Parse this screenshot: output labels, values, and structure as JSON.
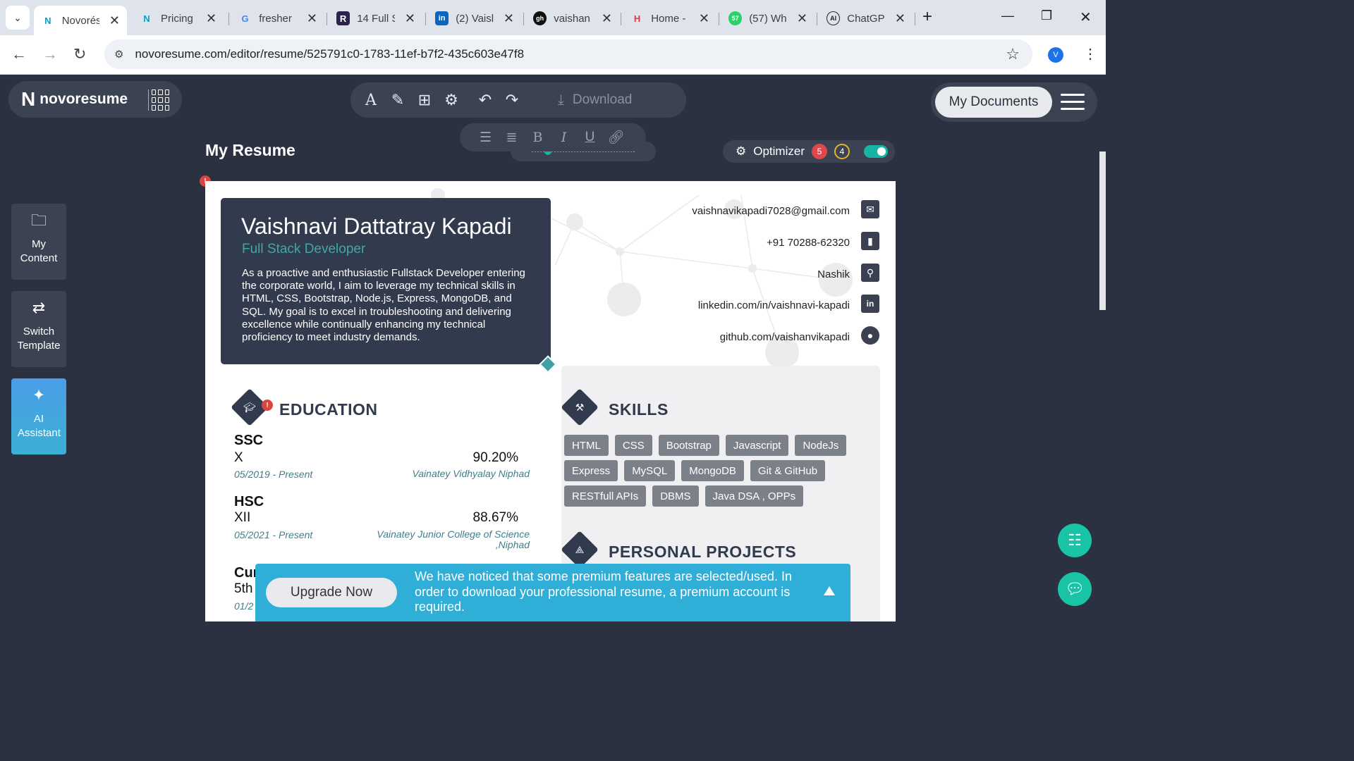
{
  "browser": {
    "tabs": [
      {
        "title": "Novorés",
        "favicon": "N",
        "active": true
      },
      {
        "title": "Pricing |",
        "favicon": "N"
      },
      {
        "title": "fresher",
        "favicon": "G"
      },
      {
        "title": "14 Full S",
        "favicon": "R"
      },
      {
        "title": "(2) Vaisl",
        "favicon": "in"
      },
      {
        "title": "vaishan",
        "favicon": "gh"
      },
      {
        "title": "Home -",
        "favicon": "H"
      },
      {
        "title": "(57) Wh",
        "favicon": "57"
      },
      {
        "title": "ChatGP",
        "favicon": "AI"
      }
    ],
    "url": "novoresume.com/editor/resume/525791c0-1783-11ef-b7f2-435c603e47f8",
    "profile_initial": "V",
    "new_tab": "+"
  },
  "app": {
    "brand": "novoresume",
    "toolbar": {
      "download_label": "Download"
    },
    "my_documents_label": "My Documents",
    "page_title": "My Resume",
    "optimizer": {
      "label": "Optimizer",
      "errors": "5",
      "warnings": "4",
      "enabled": true
    },
    "sidebar": [
      {
        "label": "My Content"
      },
      {
        "label": "Switch Template"
      },
      {
        "label": "AI Assistant"
      }
    ]
  },
  "resume": {
    "name": "Vaishnavi Dattatray Kapadi",
    "role": "Full Stack Developer",
    "summary": "As a proactive and enthusiastic Fullstack Developer entering the corporate world, I aim to leverage my technical skills in HTML, CSS, Bootstrap, Node.js, Express, MongoDB, and SQL. My goal is to excel in troubleshooting and delivering excellence while continually enhancing my technical proficiency to meet industry demands.",
    "contacts": {
      "email": "vaishnavikapadi7028@gmail.com",
      "phone": "+91 70288-62320",
      "location": "Nashik",
      "linkedin": "linkedin.com/in/vaishnavi-kapadi",
      "github": "github.com/vaishanvikapadi"
    },
    "sections": {
      "education": "EDUCATION",
      "skills": "SKILLS",
      "projects": "PERSONAL PROJECTS"
    },
    "education": [
      {
        "title": "SSC",
        "sub": "X",
        "score": "90.20%",
        "date": "05/2019 - Present",
        "institution": "Vainatey  Vidhyalay  Niphad"
      },
      {
        "title": "HSC",
        "sub": "XII",
        "score": "88.67%",
        "date": "05/2021 - Present",
        "institution_l1": "Vainatey Junior College of Science",
        "institution_l2": ",Niphad"
      },
      {
        "title": "Cur",
        "sub": "5th",
        "date": "01/2"
      }
    ],
    "skills": [
      "HTML",
      "CSS",
      "Bootstrap",
      "Javascript",
      "NodeJs",
      "Express",
      "MySQL",
      "MongoDB",
      "Git & GitHub",
      "RESTfull APIs",
      "DBMS",
      "Java DSA , OPPs"
    ]
  },
  "upgrade": {
    "button": "Upgrade Now",
    "message": "We have noticed that some premium features are selected/used. In order to download your professional resume, a premium account is required."
  },
  "colors": {
    "accent": "#17b4a4",
    "header_card": "#323a4d",
    "role": "#3fa8a6",
    "banner": "#2faed8"
  }
}
